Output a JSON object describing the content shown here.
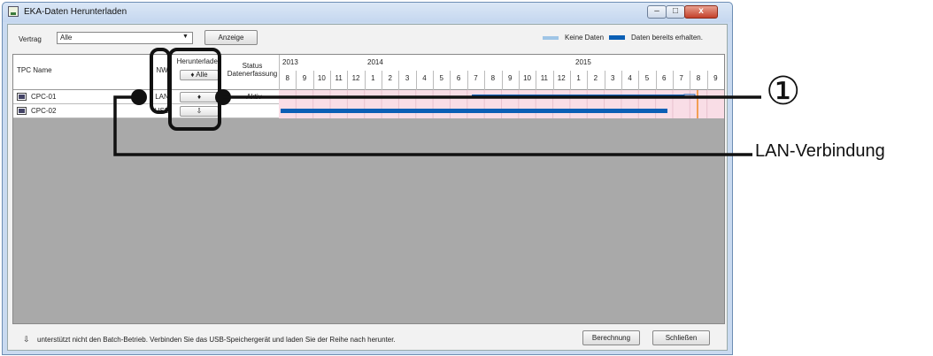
{
  "window": {
    "title": "EKA-Daten Herunterladen",
    "min": "–",
    "max": "□",
    "close": "x"
  },
  "toolbar": {
    "vertrag_label": "Vertrag",
    "vertrag_value": "Alle",
    "anzeige_label": "Anzeige",
    "legend_none": "Keine Daten",
    "legend_received": "Daten bereits erhalten."
  },
  "table": {
    "col_tpc": "TPC Name",
    "col_nw": "NW",
    "col_download": "Herunterladen",
    "col_status_1": "Status",
    "col_status_2": "Datenerfassung",
    "download_all": "♦ Alle",
    "years": [
      "2013",
      "2014",
      "2015"
    ],
    "months": [
      "8",
      "9",
      "10",
      "11",
      "12",
      "1",
      "2",
      "3",
      "4",
      "5",
      "6",
      "7",
      "8",
      "9",
      "10",
      "11",
      "12",
      "1",
      "2",
      "3",
      "4",
      "5",
      "6",
      "7",
      "8",
      "9"
    ],
    "rows": [
      {
        "name": "CPC-01",
        "nw": "LAN",
        "download": "♦",
        "status": "Aktiv"
      },
      {
        "name": "CPC-02",
        "nw": "USB",
        "download": "⇩",
        "status": ""
      }
    ]
  },
  "footer": {
    "icon": "⇩",
    "note": "unterstützt nicht den Batch-Betrieb. Verbinden Sie das USB-Speichergerät und laden Sie der Reihe nach herunter.",
    "berechnung": "Berechnung",
    "schliessen": "Schließen"
  },
  "annotation": {
    "number": "①",
    "label": "LAN-Verbindung"
  },
  "colors": {
    "bar": "#0b5fb5",
    "nodata": "#9fc5e6",
    "highlight": "#f9dde6",
    "current_month": "#f08a24"
  }
}
